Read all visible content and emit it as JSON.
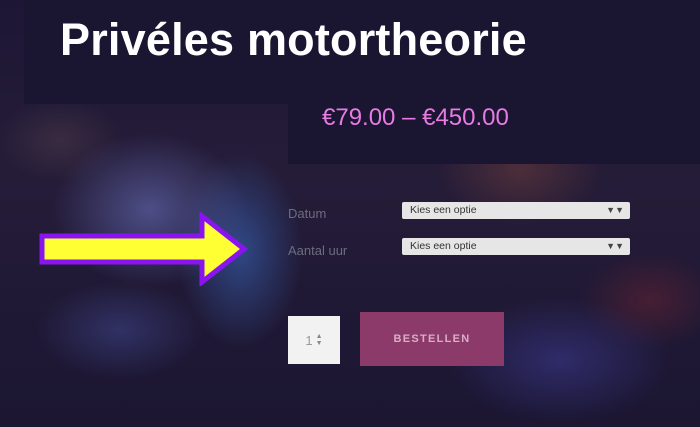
{
  "product": {
    "title": "Privéles motortheorie",
    "price_range": "€79.00 – €450.00"
  },
  "form": {
    "fields": [
      {
        "label": "Datum",
        "select_value": "Kies een optie"
      },
      {
        "label": "Aantal uur",
        "select_value": "Kies een optie"
      }
    ],
    "quantity": "1",
    "order_button": "BESTELLEN"
  },
  "annotation": {
    "arrow_fill": "#ffff33",
    "arrow_stroke": "#8a14f0"
  },
  "colors": {
    "price": "#e77be3",
    "order_button": "#8c3a6a",
    "panel": "#1a1530"
  }
}
